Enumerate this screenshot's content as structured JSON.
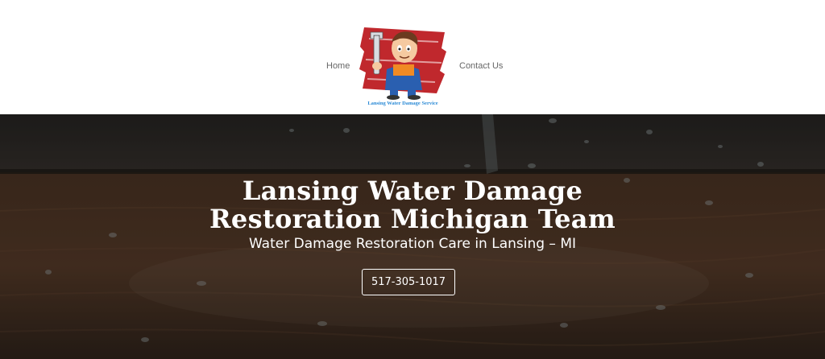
{
  "nav": {
    "home_label": "Home",
    "contact_label": "Contact Us"
  },
  "logo": {
    "caption": "Lansing Water Damage Service"
  },
  "hero": {
    "title": "Lansing Water Damage Restoration Michigan Team",
    "subtitle": "Water Damage Restoration Care in Lansing – MI",
    "phone_button_label": "517-305-1017"
  },
  "colors": {
    "nav_text": "#666666",
    "logo_red": "#c0282d",
    "logo_caption": "#2a8ad6",
    "hero_text": "#ffffff"
  }
}
